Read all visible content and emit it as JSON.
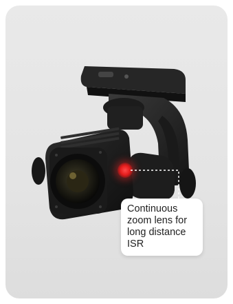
{
  "image": {
    "subject": "drone-gimbal-zoom-camera",
    "background_color": "#e6e6e6",
    "accent_color": "#e41c1c"
  },
  "annotation": {
    "label": "Continuous zoom lens for long distance ISR",
    "marker_icon": "red-dot-icon"
  }
}
